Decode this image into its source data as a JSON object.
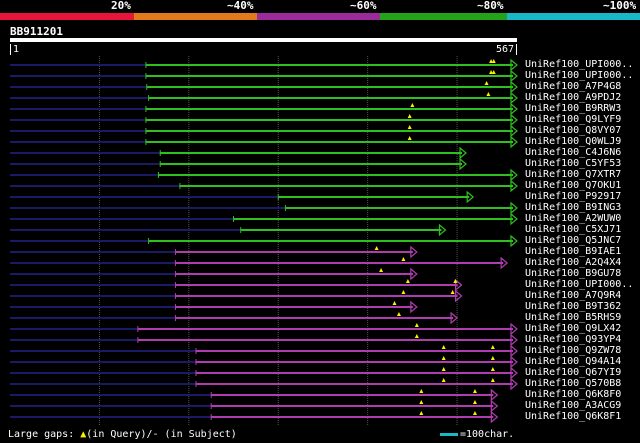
{
  "legend": {
    "segments": [
      {
        "label": "",
        "color": "#e8153a"
      },
      {
        "label": "20%",
        "color": "#e8153a"
      },
      {
        "label": "~40%",
        "color": "#e07a1a"
      },
      {
        "label": "~60%",
        "color": "#9b2a9b"
      },
      {
        "label": "~80%",
        "color": "#23a21a"
      },
      {
        "label": "~100%",
        "color": "#19b8c8"
      }
    ]
  },
  "query": {
    "name": "BB911201",
    "start": "1",
    "end": "567",
    "length": 567
  },
  "colors": {
    "green": "#2fbf1e",
    "purple": "#b03cb0",
    "navy": "#1a1a66",
    "grid": "#555555",
    "marker": "#ffee00"
  },
  "hits": [
    {
      "label": "UniRef100_UPI000..",
      "color": "green",
      "start": 152,
      "end": 567,
      "markers": [
        538,
        541
      ]
    },
    {
      "label": "UniRef100_UPI000..",
      "color": "green",
      "start": 152,
      "end": 567,
      "markers": [
        538,
        541
      ]
    },
    {
      "label": "UniRef100_A7P4G8",
      "color": "green",
      "start": 153,
      "end": 567,
      "markers": [
        533
      ]
    },
    {
      "label": "UniRef100_A9PDJ2",
      "color": "green",
      "start": 155,
      "end": 567,
      "markers": [
        535
      ]
    },
    {
      "label": "UniRef100_B9RRW3",
      "color": "green",
      "start": 152,
      "end": 567,
      "markers": [
        450
      ]
    },
    {
      "label": "UniRef100_Q9LYF9",
      "color": "green",
      "start": 152,
      "end": 567,
      "markers": [
        447
      ]
    },
    {
      "label": "UniRef100_Q8VY07",
      "color": "green",
      "start": 152,
      "end": 567,
      "markers": [
        447
      ]
    },
    {
      "label": "UniRef100_Q0WLJ9",
      "color": "green",
      "start": 152,
      "end": 567,
      "markers": [
        447
      ]
    },
    {
      "label": "UniRef100_C4J6N6",
      "color": "green",
      "start": 168,
      "end": 510,
      "markers": []
    },
    {
      "label": "UniRef100_C5YF53",
      "color": "green",
      "start": 168,
      "end": 510,
      "markers": []
    },
    {
      "label": "UniRef100_Q7XTR7",
      "color": "green",
      "start": 166,
      "end": 567,
      "markers": []
    },
    {
      "label": "UniRef100_Q7OKU1",
      "color": "green",
      "start": 190,
      "end": 567,
      "markers": []
    },
    {
      "label": "UniRef100_P92917",
      "color": "green",
      "start": 300,
      "end": 518,
      "markers": []
    },
    {
      "label": "UniRef100_B9ING3",
      "color": "green",
      "start": 308,
      "end": 567,
      "markers": []
    },
    {
      "label": "UniRef100_A2WUW0",
      "color": "green",
      "start": 250,
      "end": 567,
      "markers": []
    },
    {
      "label": "UniRef100_C5XJ71",
      "color": "green",
      "start": 258,
      "end": 487,
      "markers": []
    },
    {
      "label": "UniRef100_Q5JNC7",
      "color": "green",
      "start": 155,
      "end": 567,
      "markers": []
    },
    {
      "label": "UniRef100_B9IAE1",
      "color": "purple",
      "start": 185,
      "end": 455,
      "markers": [
        410
      ]
    },
    {
      "label": "UniRef100_A2Q4X4",
      "color": "purple",
      "start": 185,
      "end": 556,
      "markers": [
        440
      ]
    },
    {
      "label": "UniRef100_B9GU78",
      "color": "purple",
      "start": 185,
      "end": 455,
      "markers": [
        415
      ]
    },
    {
      "label": "UniRef100_UPI000..",
      "color": "purple",
      "start": 185,
      "end": 505,
      "markers": [
        445,
        498
      ]
    },
    {
      "label": "UniRef100_A7Q9R4",
      "color": "purple",
      "start": 185,
      "end": 505,
      "markers": [
        440,
        495
      ]
    },
    {
      "label": "UniRef100_B9T362",
      "color": "purple",
      "start": 185,
      "end": 455,
      "markers": [
        430
      ]
    },
    {
      "label": "UniRef100_B5RHS9",
      "color": "purple",
      "start": 185,
      "end": 500,
      "markers": [
        435
      ]
    },
    {
      "label": "UniRef100_Q9LX42",
      "color": "purple",
      "start": 143,
      "end": 567,
      "markers": [
        455
      ]
    },
    {
      "label": "UniRef100_Q93YP4",
      "color": "purple",
      "start": 143,
      "end": 567,
      "markers": [
        455
      ]
    },
    {
      "label": "UniRef100_Q9ZW78",
      "color": "purple",
      "start": 208,
      "end": 567,
      "markers": [
        485,
        540
      ]
    },
    {
      "label": "UniRef100_Q94A14",
      "color": "purple",
      "start": 208,
      "end": 567,
      "markers": [
        485,
        540
      ]
    },
    {
      "label": "UniRef100_Q67YI9",
      "color": "purple",
      "start": 208,
      "end": 567,
      "markers": [
        485,
        540
      ]
    },
    {
      "label": "UniRef100_Q570B8",
      "color": "purple",
      "start": 208,
      "end": 567,
      "markers": [
        485,
        540
      ]
    },
    {
      "label": "UniRef100_Q6K8F0",
      "color": "purple",
      "start": 225,
      "end": 545,
      "markers": [
        460,
        520
      ]
    },
    {
      "label": "UniRef100_A3ACG9",
      "color": "purple",
      "start": 225,
      "end": 545,
      "markers": [
        460,
        520
      ]
    },
    {
      "label": "UniRef100_Q6K8F1",
      "color": "purple",
      "start": 225,
      "end": 545,
      "markers": [
        460,
        520
      ]
    }
  ],
  "footer": {
    "gaps_prefix": "Large gaps: ",
    "gaps_marker": "▲",
    "gaps_suffix": "(in Query)/- (in Subject)",
    "scale_text": "=100char."
  }
}
